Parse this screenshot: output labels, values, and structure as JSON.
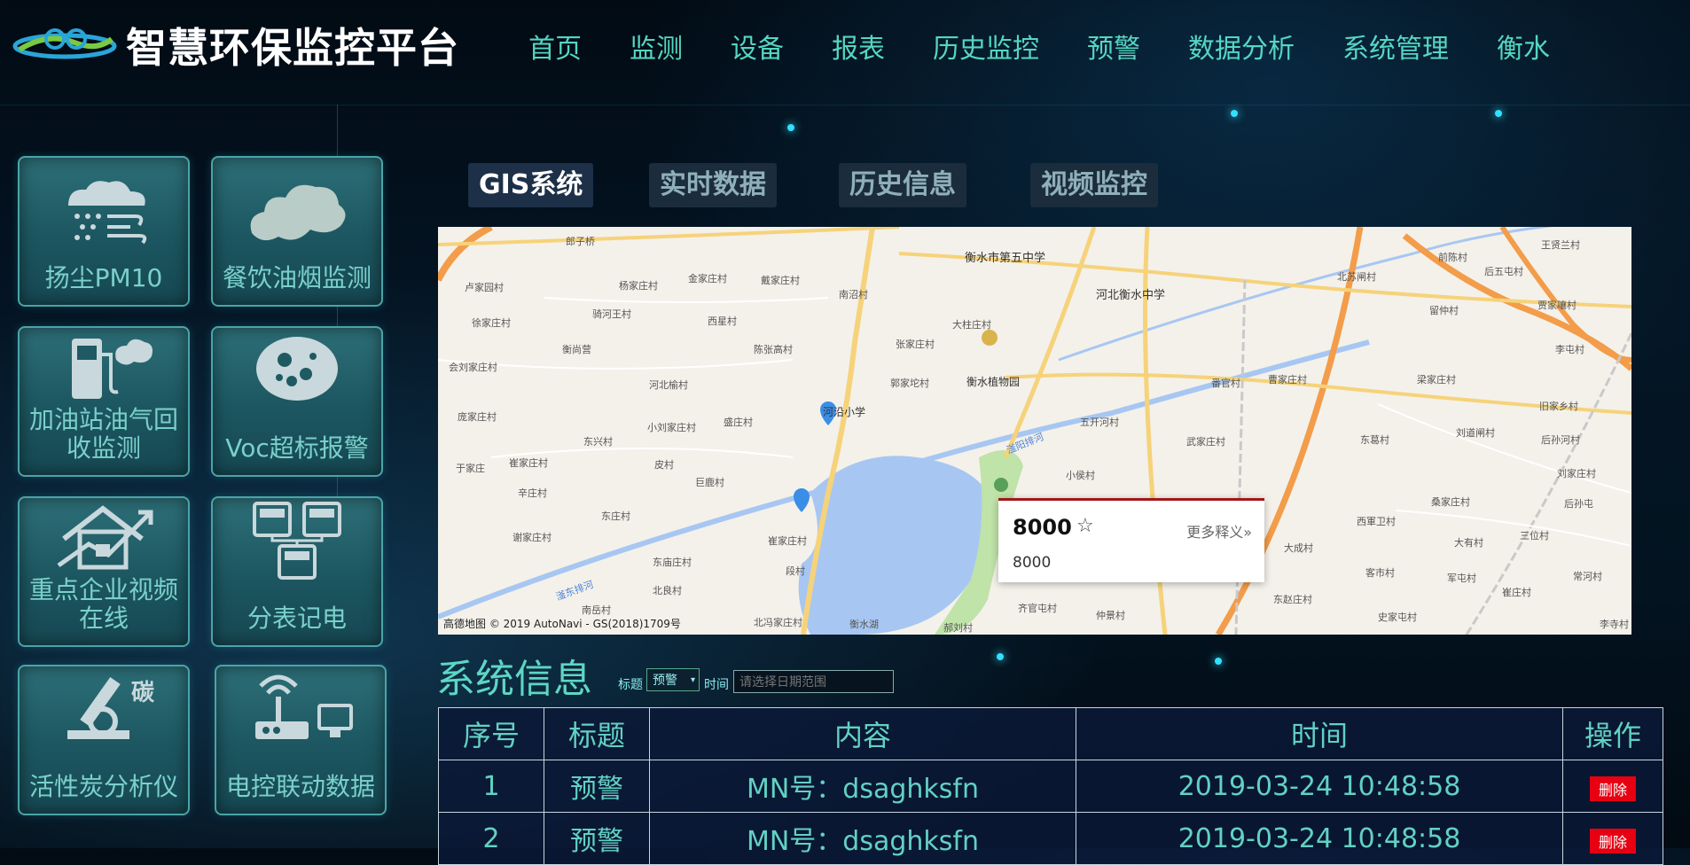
{
  "header": {
    "brand": "智慧环保监控平台",
    "nav": [
      "首页",
      "监测",
      "设备",
      "报表",
      "历史监控",
      "预警",
      "数据分析",
      "系统管理",
      "衡水"
    ]
  },
  "tiles": [
    {
      "label": "扬尘PM10",
      "icon": "cloud-dust-icon"
    },
    {
      "label": "餐饮油烟监测",
      "icon": "smoke-cloud-icon"
    },
    {
      "label": "加油站油气回收监测",
      "icon": "gas-pump-icon"
    },
    {
      "label": "Voc超标报警",
      "icon": "voc-particles-icon"
    },
    {
      "label": "重点企业视频在线",
      "icon": "house-chart-icon"
    },
    {
      "label": "分表记电",
      "icon": "electric-meter-icon"
    },
    {
      "label": "活性炭分析仪",
      "icon": "microscope-icon"
    },
    {
      "label": "电控联动数据",
      "icon": "antenna-router-icon"
    }
  ],
  "tabs": [
    "GIS系统",
    "实时数据",
    "历史信息",
    "视频监控"
  ],
  "map": {
    "places": [
      "衡水市第五中学",
      "河北衡水中学",
      "衡水植物园",
      "河沿小学",
      "五开河村",
      "大柱庄村",
      "张家庄村",
      "郭家坨村",
      "南沼村",
      "前陈村",
      "北苏闸村",
      "王贤兰村",
      "后五屯村",
      "贾家嚷村",
      "李屯村",
      "留仲村",
      "梁家庄村",
      "刘道闸村",
      "后孙河村",
      "东葛村",
      "番官村",
      "曹家庄村",
      "武家庄村",
      "小侯村",
      "大成村",
      "西軍卫村",
      "桑家庄村",
      "三位村",
      "大有村",
      "军屯村",
      "崔庄村",
      "客市村",
      "东赵庄村",
      "史家屯村",
      "齐官屯村",
      "仲景村",
      "衡水湖",
      "北冯家庄村",
      "崔家庄村",
      "段村",
      "东庙庄村",
      "南岳村",
      "北良村",
      "东庄村",
      "巨鹿村",
      "盛庄村",
      "皮村",
      "东兴村",
      "崔家庄村",
      "辛庄村",
      "于家庄",
      "谢家庄村",
      "庞家庄村",
      "会刘家庄村",
      "徐家庄村",
      "卢家园村",
      "郎子桥",
      "杨家庄村",
      "金家庄村",
      "戴家庄村",
      "骑河王村",
      "西星村",
      "衡尚营",
      "陈张高村",
      "河北榆村",
      "小刘家庄村",
      "滏东排河",
      "滏阳排河",
      "郝刘村",
      "李寺村",
      "常河村",
      "刘家庄村",
      "后孙屯",
      "旧家乡村"
    ],
    "popup": {
      "title": "8000",
      "more": "更多释义»",
      "value": "8000"
    },
    "attribution": "高德地图 © 2019 AutoNavi - GS(2018)1709号"
  },
  "system": {
    "title": "系统信息",
    "filter_title_label": "标题",
    "filter_title_value": "预警",
    "filter_time_label": "时间",
    "date_placeholder": "请选择日期范围"
  },
  "table": {
    "headers": [
      "序号",
      "标题",
      "内容",
      "时间",
      "操作"
    ],
    "rows": [
      {
        "index": "1",
        "title": "预警",
        "content": "MN号：dsaghksfn",
        "time": "2019-03-24 10:48:58",
        "action": "删除"
      },
      {
        "index": "2",
        "title": "预警",
        "content": "MN号：dsaghksfn",
        "time": "2019-03-24 10:48:58",
        "action": "删除"
      }
    ]
  },
  "colors": {
    "accent": "#55d6c2",
    "delete": "#e60012",
    "brand": "#ffffff"
  }
}
